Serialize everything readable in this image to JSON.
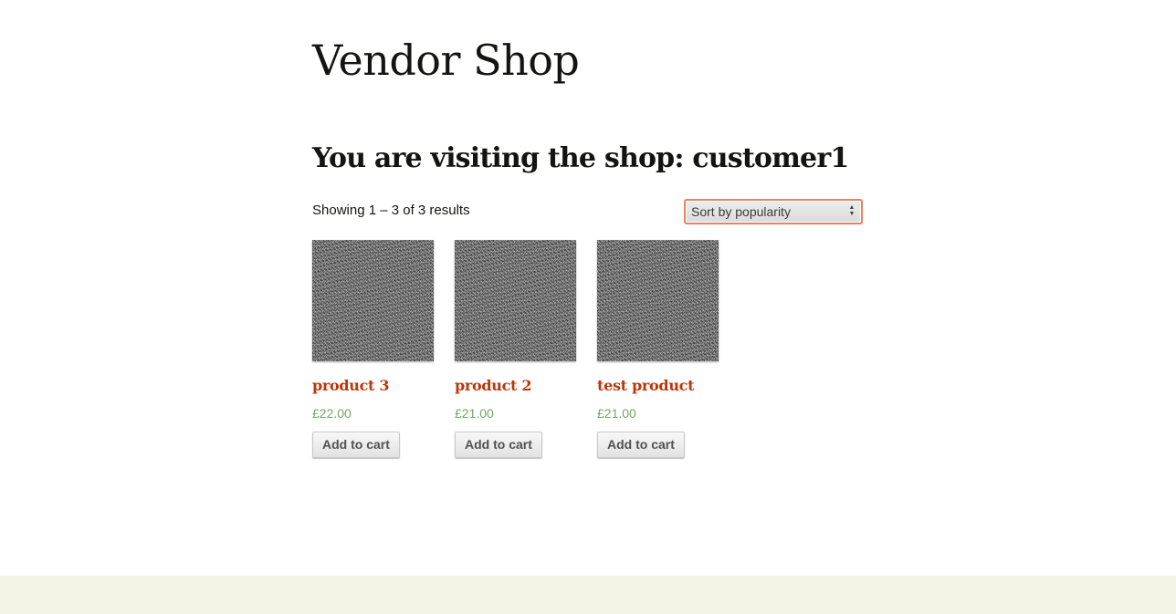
{
  "site": {
    "title": "Vendor Shop"
  },
  "shop": {
    "heading": "You are visiting the shop: customer1",
    "result_count": "Showing 1 – 3 of 3 results",
    "ordering": {
      "selected": "Sort by popularity",
      "icon": "updown-arrows-icon"
    }
  },
  "products": [
    {
      "title": "product 3",
      "price": "£22.00",
      "button_label": "Add to cart"
    },
    {
      "title": "product 2",
      "price": "£21.00",
      "button_label": "Add to cart"
    },
    {
      "title": "test product",
      "price": "£21.00",
      "button_label": "Add to cart"
    }
  ],
  "colors": {
    "product_title": "#bc360a",
    "price": "#77a464",
    "select_focus_border": "#e8845c",
    "footer_background": "#f5f2e6"
  }
}
